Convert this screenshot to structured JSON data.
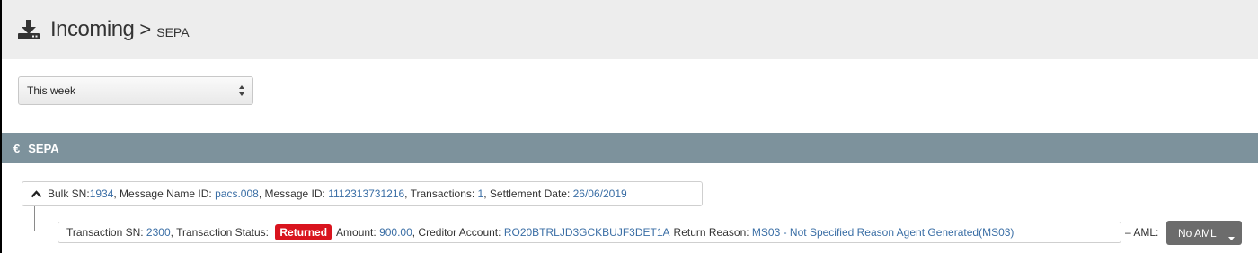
{
  "header": {
    "title": "Incoming",
    "separator": ">",
    "subtitle": "SEPA",
    "icon": "download-icon"
  },
  "filter": {
    "selected": "This week"
  },
  "section": {
    "icon": "€",
    "title": "SEPA"
  },
  "bulk": {
    "bulk_sn_label": "Bulk SN: ",
    "bulk_sn": "1934",
    "message_name_label": ", Message Name ID: ",
    "message_name_id": "pacs.008",
    "message_id_label": ", Message ID: ",
    "message_id": "1112313731216",
    "transactions_label": ", Transactions: ",
    "transactions": "1",
    "settlement_label": ", Settlement Date: ",
    "settlement_date": "26/06/2019"
  },
  "transaction": {
    "sn_label": "Transaction SN: ",
    "sn": "2300",
    "status_label": ", Transaction Status: ",
    "status": "Returned",
    "amount_label": "Amount: ",
    "amount": "900.00",
    "creditor_label": ", Creditor Account: ",
    "creditor_account": "RO20BTRLJD3GCKBUJF3DET1A",
    "return_reason_label": "Return Reason: ",
    "return_reason": "MS03 - Not Specified Reason Agent Generated(MS03)"
  },
  "aml": {
    "label": "– AML:",
    "button_label": "No AML"
  },
  "colors": {
    "header_bg": "#ededed",
    "section_bar": "#7d929c",
    "link": "#3a6ea5",
    "returned_badge": "#d9141e",
    "aml_button": "#6c6c6c"
  }
}
